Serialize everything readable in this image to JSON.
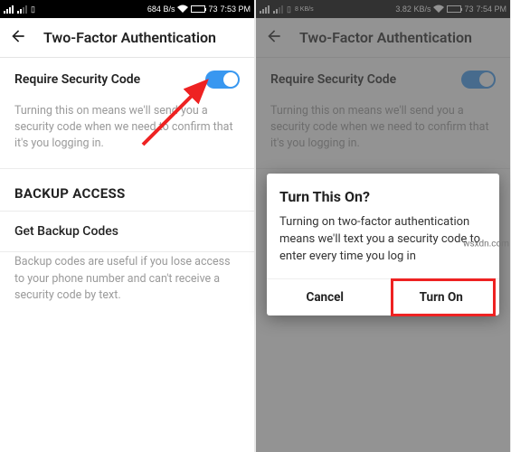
{
  "left": {
    "status": {
      "net": "684 B/s",
      "batt": "73",
      "time": "7:53 PM"
    },
    "title": "Two-Factor Authentication",
    "require_label": "Require Security Code",
    "require_hint": "Turning this on means we'll send you a security code when we need to confirm that it's you logging in.",
    "backup_heading": "BACKUP ACCESS",
    "backup_item": "Get Backup Codes",
    "backup_hint": "Backup codes are useful if you lose access to your phone number and can't receive a security code by text."
  },
  "right": {
    "status": {
      "net": "3.82 KB/s",
      "batt": "73",
      "time": "7:54 PM"
    },
    "title": "Two-Factor Authentication",
    "require_label": "Require Security Code",
    "require_hint": "Turning this on means we'll send you a security code when we need to confirm that it's you logging in.",
    "dialog": {
      "title": "Turn This On?",
      "body": "Turning on two-factor authentication means we'll text you a security code to enter every time you log in",
      "cancel": "Cancel",
      "confirm": "Turn On"
    }
  },
  "icons": {
    "sim1": "..ıl",
    "sim2": "ıl..",
    "sim_slot": "ı",
    "wifi": "wifi",
    "speed": "8 KB/s"
  },
  "watermark": "wsxdn.com"
}
